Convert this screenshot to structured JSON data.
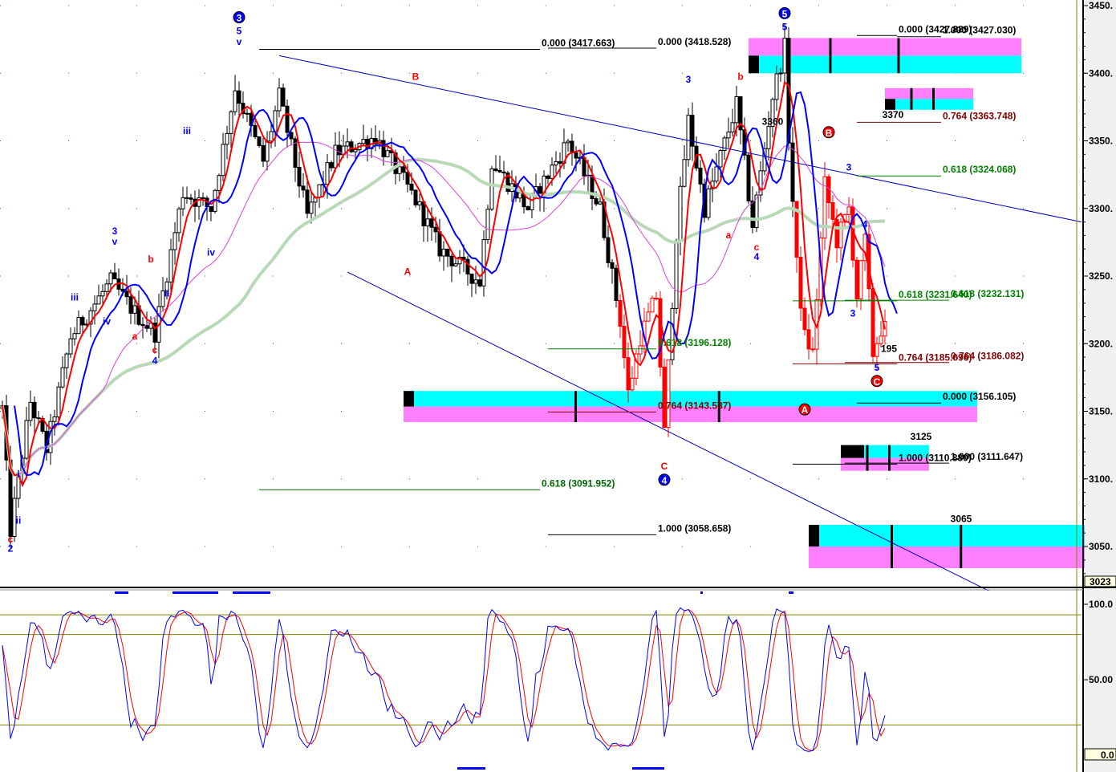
{
  "chart_data": {
    "type": "candlestick",
    "title": "",
    "price_axis": {
      "ylim": [
        3023,
        3450
      ],
      "ticks": [
        "3450.",
        "3400.",
        "3350.",
        "3300.",
        "3250.",
        "3200.",
        "3150.",
        "3100.",
        "3050."
      ],
      "tick_values": [
        3450,
        3400,
        3350,
        3300,
        3250,
        3200,
        3150,
        3100,
        3050
      ],
      "last_value_box": "3023"
    },
    "oscillator_axis": {
      "ylim": [
        0,
        100
      ],
      "ticks": [
        "100.0",
        "50.00"
      ],
      "tick_values": [
        100,
        50
      ],
      "last_value_box": "0.0",
      "levels": [
        93,
        80,
        20
      ]
    },
    "bars": 221,
    "price_waypoints": [
      [
        0,
        3152
      ],
      [
        2,
        3062
      ],
      [
        7,
        3157
      ],
      [
        11,
        3122
      ],
      [
        17,
        3205
      ],
      [
        27,
        3246
      ],
      [
        33,
        3223
      ],
      [
        38,
        3208
      ],
      [
        45,
        3312
      ],
      [
        52,
        3300
      ],
      [
        58,
        3389
      ],
      [
        65,
        3335
      ],
      [
        69,
        3383
      ],
      [
        76,
        3294
      ],
      [
        83,
        3341
      ],
      [
        93,
        3353
      ],
      [
        103,
        3306
      ],
      [
        109,
        3270
      ],
      [
        119,
        3246
      ],
      [
        122,
        3335
      ],
      [
        131,
        3300
      ],
      [
        141,
        3350
      ],
      [
        149,
        3300
      ],
      [
        154,
        3217
      ],
      [
        156,
        3163
      ],
      [
        159,
        3205
      ],
      [
        163,
        3235
      ],
      [
        165,
        3134
      ],
      [
        168,
        3282
      ],
      [
        171,
        3365
      ],
      [
        175,
        3300
      ],
      [
        183,
        3377
      ],
      [
        187,
        3288
      ],
      [
        192,
        3383
      ],
      [
        195,
        3419
      ],
      [
        196,
        3353
      ],
      [
        198,
        3258
      ],
      [
        200,
        3205
      ],
      [
        202,
        3193
      ],
      [
        205,
        3318
      ],
      [
        208,
        3276
      ],
      [
        211,
        3300
      ],
      [
        213,
        3235
      ],
      [
        215,
        3276
      ],
      [
        217,
        3193
      ],
      [
        219,
        3211
      ]
    ],
    "red_bar_ranges": [
      [
        154,
        166
      ],
      [
        198,
        220
      ]
    ],
    "colors": {
      "fast_ma": "#ff0000",
      "displaced_ma": "#0000ff",
      "mid_ma": "#e040e0",
      "slow_ma": "#b8d8b8",
      "stoch_k": "#0000ff",
      "stoch_d": "#ff0000",
      "zone_cyan": "#00ffff",
      "zone_magenta": "#ff80ff",
      "trendline": "#0000c0"
    },
    "trendlines": [
      [
        [
          69,
          3413
        ],
        [
          269,
          3290
        ]
      ],
      [
        [
          86,
          3253
        ],
        [
          246,
          3017
        ]
      ]
    ],
    "fib_levels": [
      {
        "label": "0.000 (3417.663)",
        "price": 3417.663,
        "from_bar": 64,
        "to_bar": 134,
        "color": "#000000"
      },
      {
        "label": "0.000 (3418.528)",
        "price": 3418.528,
        "from_bar": 136,
        "to_bar": 163,
        "color": "#000000"
      },
      {
        "label": "0.618 (3091.952)",
        "price": 3091.952,
        "from_bar": 64,
        "to_bar": 134,
        "color": "#006600"
      },
      {
        "label": "1.000 (3058.658)",
        "price": 3058.658,
        "from_bar": 136,
        "to_bar": 163,
        "color": "#000000"
      },
      {
        "label": "0.618 (3196.128)",
        "price": 3196.128,
        "from_bar": 136,
        "to_bar": 163,
        "color": "#008000"
      },
      {
        "label": "0.764 (3143.587)",
        "price": 3149.5,
        "from_bar": 136,
        "to_bar": 163,
        "color": "#800000"
      },
      {
        "label": "0.000 (3156.105)",
        "price": 3156.105,
        "from_bar": 213,
        "to_bar": 234,
        "color": "#000000"
      },
      {
        "label": "0.618 (3231.640)",
        "price": 3231.64,
        "from_bar": 197,
        "to_bar": 223,
        "color": "#008000"
      },
      {
        "label": "0.618 (3232.131)",
        "price": 3232.131,
        "from_bar": 210,
        "to_bar": 236,
        "color": "#008000"
      },
      {
        "label": "0.764 (3185.096)",
        "price": 3185.096,
        "from_bar": 197,
        "to_bar": 223,
        "color": "#800000"
      },
      {
        "label": "0.764 (3186.082)",
        "price": 3186.082,
        "from_bar": 210,
        "to_bar": 236,
        "color": "#800000"
      },
      {
        "label": "1.000 (3110.880)",
        "price": 3110.88,
        "from_bar": 197,
        "to_bar": 223,
        "color": "#000000"
      },
      {
        "label": "1.000 (3111.647)",
        "price": 3111.647,
        "from_bar": 210,
        "to_bar": 236,
        "color": "#000000"
      },
      {
        "label": "0.618 (3324.068)",
        "price": 3324.068,
        "from_bar": 213,
        "to_bar": 234,
        "color": "#008000"
      },
      {
        "label": "0.764 (3363.748)",
        "price": 3363.748,
        "from_bar": 213,
        "to_bar": 234,
        "color": "#800000"
      },
      {
        "label": "0.000 (3427.889)",
        "price": 3427.889,
        "from_bar": 213,
        "to_bar": 223,
        "color": "#000000"
      },
      {
        "label": "1.000 (3427.030)",
        "price": 3427.03,
        "from_bar": 223,
        "to_bar": 234,
        "color": "#000000"
      }
    ],
    "zones": [
      {
        "from_bar": 186,
        "to_bar": 254,
        "top": 3426,
        "bottom": 3400,
        "upper": "magenta",
        "lower": "cyan"
      },
      {
        "from_bar": 220,
        "to_bar": 242,
        "top": 3389,
        "bottom": 3373,
        "upper": "magenta",
        "lower": "cyan"
      },
      {
        "from_bar": 100,
        "to_bar": 243,
        "top": 3165,
        "bottom": 3142,
        "upper": "cyan",
        "lower": "magenta"
      },
      {
        "from_bar": 209,
        "to_bar": 231,
        "top": 3125,
        "bottom": 3106,
        "upper": "cyan",
        "lower": "magenta"
      },
      {
        "from_bar": 201,
        "to_bar": 270,
        "top": 3066,
        "bottom": 3034,
        "upper": "cyan",
        "lower": "magenta"
      }
    ],
    "annotations": [
      {
        "text": "c",
        "bar": 2,
        "price": 3053,
        "color": "#ff0000"
      },
      {
        "text": "2",
        "bar": 2,
        "price": 3046,
        "color": "#0000ff"
      },
      {
        "text": "i",
        "bar": 4,
        "price": 3101,
        "color": "#0000ff"
      },
      {
        "text": "ii",
        "bar": 4,
        "price": 3067,
        "color": "#0000ff"
      },
      {
        "text": "iii",
        "bar": 18,
        "price": 3232,
        "color": "#0000ff"
      },
      {
        "text": "3",
        "bar": 28,
        "price": 3281,
        "color": "#0000ff"
      },
      {
        "text": "v",
        "bar": 28,
        "price": 3273,
        "color": "#0000ff"
      },
      {
        "text": "iv",
        "bar": 26,
        "price": 3214,
        "color": "#0000ff"
      },
      {
        "text": "a",
        "bar": 33,
        "price": 3203,
        "color": "#ff0000"
      },
      {
        "text": "b",
        "bar": 37,
        "price": 3260,
        "color": "#ff0000"
      },
      {
        "text": "c",
        "bar": 38,
        "price": 3193,
        "color": "#ff0000"
      },
      {
        "text": "4",
        "bar": 38,
        "price": 3185,
        "color": "#0000ff"
      },
      {
        "text": "ii",
        "bar": 41,
        "price": 3235,
        "color": "#0000ff"
      },
      {
        "text": "iii",
        "bar": 46,
        "price": 3355,
        "color": "#0000ff"
      },
      {
        "text": "iv",
        "bar": 52,
        "price": 3265,
        "color": "#0000ff"
      },
      {
        "text": "3",
        "bar": 59,
        "price": 3439,
        "color": "#0000ff",
        "circle": true
      },
      {
        "text": "5",
        "bar": 59,
        "price": 3429,
        "color": "#0000ff"
      },
      {
        "text": "v",
        "bar": 59,
        "price": 3421,
        "color": "#0000ff"
      },
      {
        "text": "B",
        "bar": 103,
        "price": 3395,
        "color": "#ff0000"
      },
      {
        "text": "A",
        "bar": 101,
        "price": 3251,
        "color": "#ff0000"
      },
      {
        "text": "3",
        "bar": 171,
        "price": 3393,
        "color": "#0000ff"
      },
      {
        "text": "b",
        "bar": 184,
        "price": 3395,
        "color": "#ff0000"
      },
      {
        "text": "a",
        "bar": 181,
        "price": 3278,
        "color": "#ff0000"
      },
      {
        "text": "c",
        "bar": 188,
        "price": 3269,
        "color": "#ff0000"
      },
      {
        "text": "4",
        "bar": 188,
        "price": 3262,
        "color": "#0000ff"
      },
      {
        "text": "3360",
        "bar": 192,
        "price": 3362,
        "color": "#000000"
      },
      {
        "text": "5",
        "bar": 195,
        "price": 3442,
        "color": "#0000ff",
        "circle": true
      },
      {
        "text": "5",
        "bar": 195,
        "price": 3432,
        "color": "#0000ff"
      },
      {
        "text": "B",
        "bar": 206,
        "price": 3354,
        "color": "#ff0000",
        "circle": true
      },
      {
        "text": "3",
        "bar": 211,
        "price": 3328,
        "color": "#0000ff"
      },
      {
        "text": "4",
        "bar": 215,
        "price": 3286,
        "color": "#0000ff"
      },
      {
        "text": "3",
        "bar": 212,
        "price": 3220,
        "color": "#0000ff"
      },
      {
        "text": "5",
        "bar": 218,
        "price": 3180,
        "color": "#0000ff"
      },
      {
        "text": "C",
        "bar": 218,
        "price": 3170,
        "color": "#ff0000",
        "circle": true
      },
      {
        "text": "195",
        "bar": 221,
        "price": 3194,
        "color": "#000000"
      },
      {
        "text": "A",
        "bar": 200,
        "price": 3149,
        "color": "#ff0000",
        "circle": true
      },
      {
        "text": "3370",
        "bar": 222,
        "price": 3367,
        "color": "#000000"
      },
      {
        "text": "3125",
        "bar": 229,
        "price": 3129,
        "color": "#000000"
      },
      {
        "text": "3065",
        "bar": 239,
        "price": 3068,
        "color": "#000000"
      },
      {
        "text": "C",
        "bar": 165,
        "price": 3107,
        "color": "#ff0000"
      },
      {
        "text": "4",
        "bar": 165,
        "price": 3097,
        "color": "#0000ff",
        "circle": true
      }
    ]
  }
}
